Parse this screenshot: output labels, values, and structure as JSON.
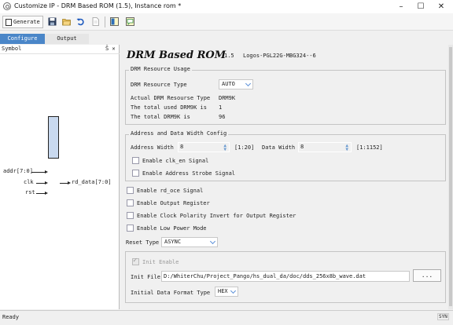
{
  "window": {
    "title": "Customize IP - DRM Based ROM (1.5), Instance rom *",
    "minimize": "–",
    "maximize": "☐",
    "close": "✕"
  },
  "toolbar": {
    "generate_label": "Generate",
    "icons": [
      "save-icon",
      "open-folder-icon",
      "undo-icon",
      "document-icon",
      "panel-toggle-icon",
      "comment-icon"
    ]
  },
  "tabs": [
    {
      "label": "Configure",
      "active": true
    },
    {
      "label": "Output",
      "active": false
    }
  ],
  "symbol_panel": {
    "title": "Symbol",
    "controls": "Š ✕",
    "inputs": [
      "addr[7:0]",
      "clk",
      "rst"
    ],
    "outputs": [
      "rd_data[7:0]"
    ]
  },
  "config": {
    "title": "DRM Based ROM",
    "version": "1.5",
    "device": "Logos-PGL22G-MBG324--6",
    "resource_group": {
      "label": "DRM Resource Usage",
      "resource_type_label": "DRM Resource Type",
      "resource_type_value": "AUTO",
      "actual_label": "Actual DRM Resourse Type",
      "actual_value": "DRM9K",
      "used_label": "The total used DRM9K is",
      "used_value": "1",
      "total_label": "The total DRM9K is",
      "total_value": "96"
    },
    "addr_group": {
      "label": "Address and Data Width Config",
      "addr_width_label": "Address Width",
      "addr_width_value": "8",
      "addr_range": "[1:20]",
      "data_width_label": "Data Width",
      "data_width_value": "8",
      "data_range": "[1:1152]",
      "clk_en_label": "Enable clk_en Signal",
      "clk_en_checked": false,
      "addr_strobe_label": "Enable Address Strobe Signal",
      "addr_strobe_checked": false
    },
    "options": [
      {
        "label": "Enable rd_oce Signal",
        "checked": false
      },
      {
        "label": "Enable Output Register",
        "checked": false
      },
      {
        "label": "Enable Clock Polarity Invert for Output Register",
        "checked": false
      },
      {
        "label": "Enable Low Power Mode",
        "checked": false
      }
    ],
    "reset_type_label": "Reset Type",
    "reset_type_value": "ASYNC",
    "init_group": {
      "init_enable_label": "Init Enable",
      "init_enable_checked": true,
      "init_file_label": "Init File",
      "init_file_value": "D:/WhiterChu/Project_Pango/hs_dual_da/doc/dds_256x8b_wave.dat",
      "browse_label": "...",
      "format_label": "Initial Data Format Type",
      "format_value": "HEX"
    }
  },
  "status": {
    "text": "Ready",
    "indicator": "SYN"
  },
  "colors": {
    "accent": "#4a86c8",
    "block_fill": "#c9d9ef",
    "combo_chevron": "#5a8fd8"
  }
}
